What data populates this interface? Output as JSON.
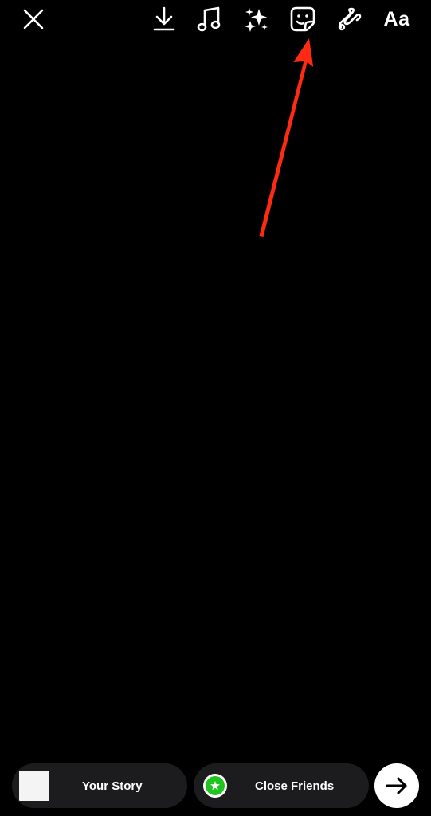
{
  "toolbar": {
    "text_tool_label": "Aa",
    "icons": [
      "close-icon",
      "download-icon",
      "music-icon",
      "effects-sparkle-icon",
      "sticker-icon",
      "draw-squiggle-icon"
    ]
  },
  "share_bar": {
    "your_story_label": "Your Story",
    "close_friends_label": "Close Friends",
    "close_friends_color": "#1ec51e",
    "send_icon": "arrow-right-icon"
  },
  "annotation": {
    "arrow_color": "#ff2a12",
    "points_to": "sticker-icon"
  },
  "colors": {
    "background": "#000000",
    "pill_background": "#1c1c1e",
    "foreground": "#ffffff"
  }
}
